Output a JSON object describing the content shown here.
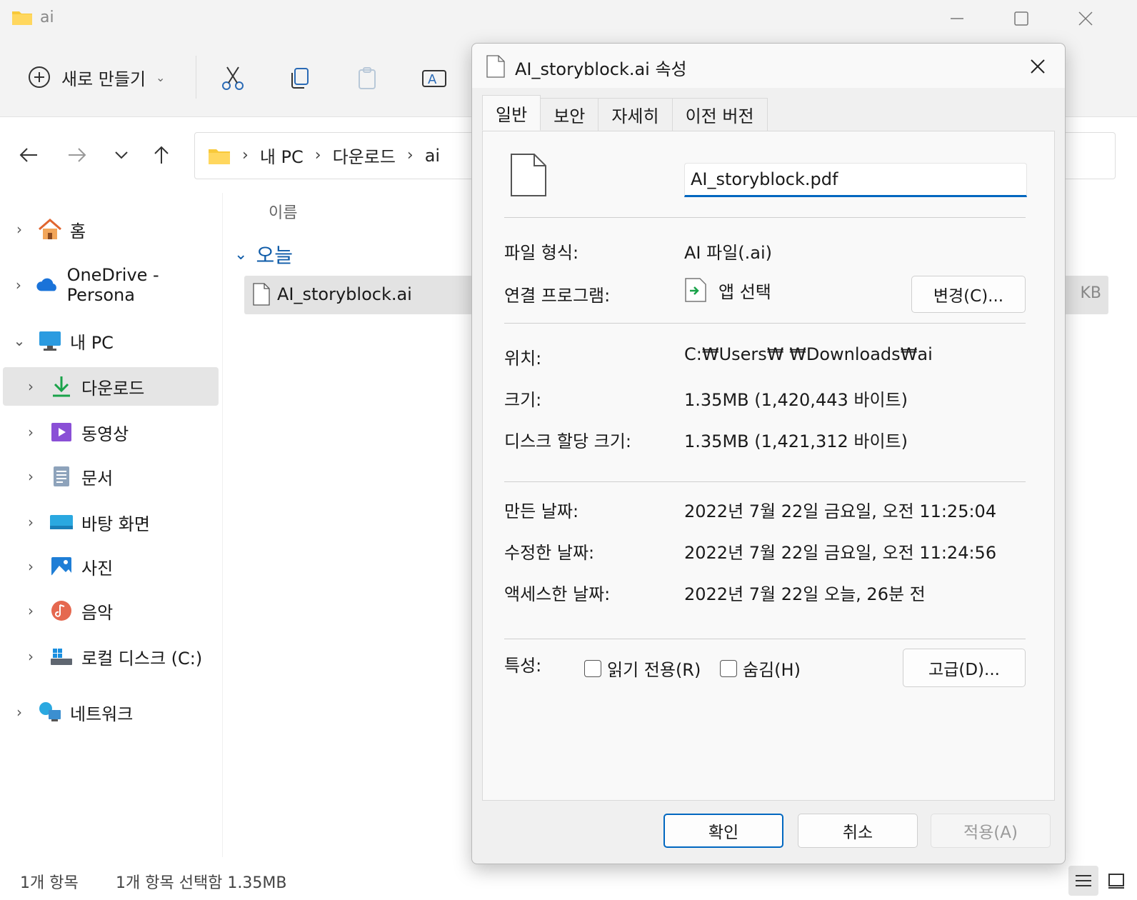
{
  "window": {
    "title": "ai"
  },
  "toolbar": {
    "new_label": "새로 만들기"
  },
  "breadcrumb": {
    "items": [
      "내 PC",
      "다운로드",
      "ai"
    ]
  },
  "sidebar": {
    "items": [
      {
        "label": "홈"
      },
      {
        "label": "OneDrive - Persona"
      },
      {
        "label": "내 PC"
      },
      {
        "label": "다운로드"
      },
      {
        "label": "동영상"
      },
      {
        "label": "문서"
      },
      {
        "label": "바탕 화면"
      },
      {
        "label": "사진"
      },
      {
        "label": "음악"
      },
      {
        "label": "로컬 디스크 (C:)"
      },
      {
        "label": "네트워크"
      }
    ]
  },
  "filelist": {
    "column_name": "이름",
    "group": "오늘",
    "file": {
      "name": "AI_storyblock.ai",
      "size": "KB"
    }
  },
  "status": {
    "count": "1개 항목",
    "selection": "1개 항목 선택함 1.35MB"
  },
  "dialog": {
    "title": "AI_storyblock.ai 속성",
    "tabs": [
      "일반",
      "보안",
      "자세히",
      "이전 버전"
    ],
    "filename_value": "AI_storyblock.pdf",
    "rows": {
      "type_label": "파일 형식:",
      "type_value": "AI 파일(.ai)",
      "opens_label": "연결 프로그램:",
      "opens_value": "앱 선택",
      "change_btn": "변경(C)...",
      "location_label": "위치:",
      "location_value": "C:₩Users₩ ₩Downloads₩ai",
      "size_label": "크기:",
      "size_value": "1.35MB (1,420,443 바이트)",
      "disk_label": "디스크 할당 크기:",
      "disk_value": "1.35MB (1,421,312 바이트)",
      "created_label": "만든 날짜:",
      "created_value": "2022년 7월 22일 금요일, 오전 11:25:04",
      "modified_label": "수정한 날짜:",
      "modified_value": "2022년 7월 22일 금요일, 오전 11:24:56",
      "accessed_label": "액세스한 날짜:",
      "accessed_value": "2022년 7월 22일 오늘, 26분 전",
      "attr_label": "특성:",
      "readonly_label": "읽기 전용(R)",
      "hidden_label": "숨김(H)",
      "advanced_btn": "고급(D)..."
    },
    "buttons": {
      "ok": "확인",
      "cancel": "취소",
      "apply": "적용(A)"
    }
  }
}
